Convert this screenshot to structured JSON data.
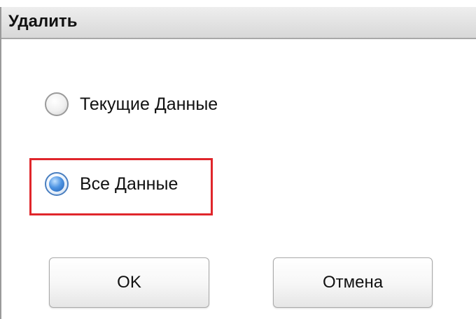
{
  "dialog": {
    "title": "Удалить"
  },
  "options": {
    "current": {
      "label": "Текущие Данные",
      "checked": false
    },
    "all": {
      "label": "Все Данные",
      "checked": true
    }
  },
  "buttons": {
    "ok_label": "OK",
    "cancel_label": "Отмена"
  },
  "colors": {
    "highlight": "#e0262b",
    "radio_selected": "#1f5fb4",
    "titlebar": "#e2e2e2"
  }
}
